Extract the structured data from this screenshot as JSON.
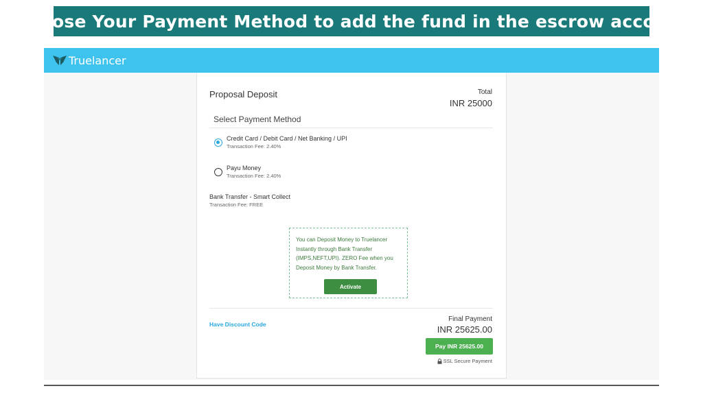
{
  "banner": {
    "text": "Choose Your Payment Method to add the fund in the escrow account"
  },
  "header": {
    "brand": "Truelancer",
    "color": "#3ec3ef"
  },
  "card": {
    "title": "Proposal Deposit",
    "total_label": "Total",
    "total_amount": "INR 25000",
    "method_heading": "Select Payment Method",
    "options": [
      {
        "label": "Credit Card / Debit Card / Net Banking / UPI",
        "fee": "Transaction Fee: 2.40%",
        "selected": true
      },
      {
        "label": "Payu Money",
        "fee": "Transaction Fee: 2.40%",
        "selected": false
      }
    ],
    "bank": {
      "label": "Bank Transfer - Smart Collect",
      "fee": "Transaction Fee: FREE"
    },
    "info": {
      "text": "You can Deposit Money to Truelancer Instantly through Bank Transfer (IMPS,NEFT,UPI). ZERO Fee when you Deposit Money by Bank Transfer.",
      "button": "Activate"
    },
    "discount_link": "Have Discount Code",
    "final_label": "Final Payment",
    "final_amount": "INR 25625.00",
    "pay_button": "Pay INR 25625.00",
    "secure_text": "SSL Secure Payment"
  }
}
